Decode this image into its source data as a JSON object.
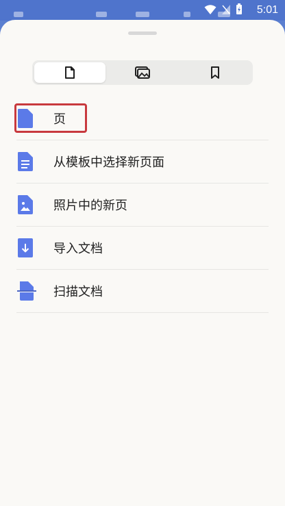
{
  "status_bar": {
    "time": "5:01"
  },
  "tabs": [
    {
      "icon": "page-icon",
      "active": true
    },
    {
      "icon": "images-icon",
      "active": false
    },
    {
      "icon": "bookmark-icon",
      "active": false
    }
  ],
  "menu": {
    "items": [
      {
        "label": "页",
        "icon": "blank-page-icon"
      },
      {
        "label": "从模板中选择新页面",
        "icon": "template-page-icon"
      },
      {
        "label": "照片中的新页",
        "icon": "photo-page-icon"
      },
      {
        "label": "导入文档",
        "icon": "import-document-icon"
      },
      {
        "label": "扫描文档",
        "icon": "scan-document-icon"
      }
    ]
  },
  "colors": {
    "accent": "#5b7ae8",
    "highlight_border": "#c8393e",
    "sheet_background": "#faf9f6",
    "status_bar": "#4f74cc"
  }
}
